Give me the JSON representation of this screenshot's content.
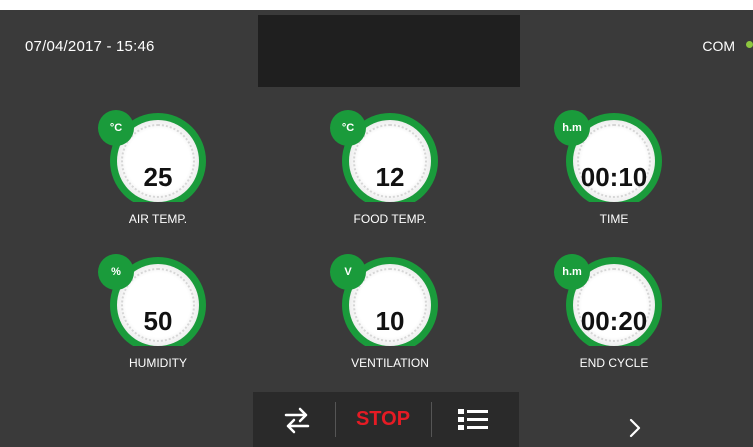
{
  "header": {
    "datetime": "07/04/2017 - 15:46",
    "com_label": "COM",
    "com_status_color": "#8dc63f"
  },
  "dials": [
    {
      "unit": "°C",
      "value": "25",
      "label": "AIR TEMP."
    },
    {
      "unit": "°C",
      "value": "12",
      "label": "FOOD TEMP."
    },
    {
      "unit": "h.m",
      "value": "00:10",
      "label": "TIME"
    },
    {
      "unit": "%",
      "value": "50",
      "label": "HUMIDITY"
    },
    {
      "unit": "V",
      "value": "10",
      "label": "VENTILATION"
    },
    {
      "unit": "h.m",
      "value": "00:20",
      "label": "END CYCLE"
    }
  ],
  "toolbar": {
    "swap_icon": "swap-arrows-icon",
    "stop_label": "STOP",
    "menu_icon": "list-menu-icon",
    "next_icon": "chevron-right-icon"
  },
  "colors": {
    "accent_green": "#1a9b3b",
    "stop_red": "#e51b24",
    "background": "#3a3a3a"
  }
}
